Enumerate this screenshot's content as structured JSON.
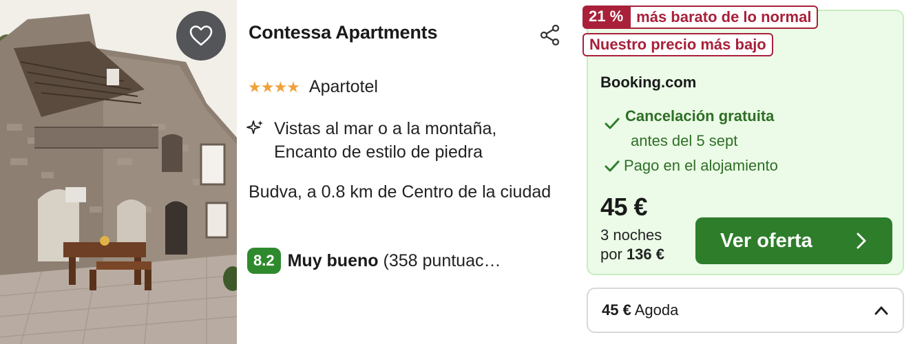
{
  "hotel": {
    "name": "Contessa Apartments",
    "stars": "★★★★",
    "type": "Apartotel",
    "features": "Vistas al mar o a la montaña, Encanto de estilo de piedra",
    "location": "Budva, a 0.8 km de Centro de la ciudad",
    "rating_score": "8.2",
    "rating_label": "Muy bueno",
    "rating_count": "(358 puntuac…"
  },
  "deal": {
    "discount_percent": "21 %",
    "discount_text": "más barato de lo normal",
    "lowest_badge": "Nuestro precio más bajo",
    "provider": "Booking.com",
    "perk_cancel": "Cancelación gratuita",
    "perk_cancel_sub": "antes del 5 sept",
    "perk_pay": "Pago en el alojamiento",
    "price": "45 €",
    "nights_label": "3 noches",
    "total_prefix": "por",
    "total": "136 €",
    "cta_label": "Ver oferta"
  },
  "alt_offer": {
    "price": "45 €",
    "provider": "Agoda"
  },
  "colors": {
    "accent_green": "#2e7d2b",
    "deal_bg": "#ebfbe7",
    "discount_red": "#a8203a",
    "star_orange": "#f0a13b"
  },
  "icons": [
    "heart-icon",
    "share-icon",
    "sparkle-icon",
    "check-icon",
    "chevron-right-icon",
    "chevron-up-icon"
  ]
}
